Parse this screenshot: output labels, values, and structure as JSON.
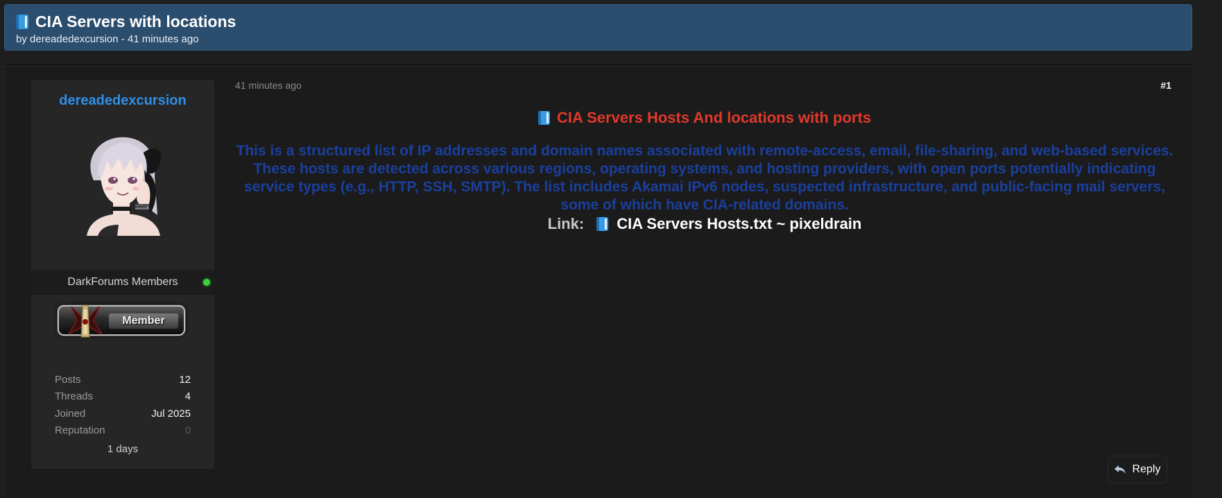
{
  "thread": {
    "title": "CIA Servers with locations",
    "by_prefix": "by",
    "author": "dereadedexcursion",
    "separator": "-",
    "time_ago": "41 minutes ago"
  },
  "post": {
    "date": "41 minutes ago",
    "number": "#1",
    "heading": "CIA Servers Hosts And locations with ports",
    "paragraph": "This is a structured list of IP addresses and domain names associated with remote-access, email, file-sharing, and web-based services. These hosts are detected across various regions, operating systems, and hosting providers, with open ports potentially indicating service types (e.g., HTTP, SSH, SMTP). The list includes Akamai IPv6 nodes, suspected infrastructure, and public-facing mail servers, some of which have CIA-related domains.",
    "link_label": "Link:",
    "link_text": "CIA Servers Hosts.txt ~ pixeldrain",
    "colors": {
      "heading": "#e0392b",
      "paragraph": "#1a3f9e"
    }
  },
  "author_card": {
    "username": "dereadedexcursion",
    "usergroup": "DarkForums Members",
    "online": true,
    "rank_badge": "Member",
    "stats": [
      {
        "label": "Posts",
        "value": "12"
      },
      {
        "label": "Threads",
        "value": "4"
      },
      {
        "label": "Joined",
        "value": "Jul 2025"
      },
      {
        "label": "Reputation",
        "value": "0"
      }
    ],
    "extra": "1 days"
  },
  "actions": {
    "reply_label": "Reply"
  },
  "icons": {
    "title": "book-icon",
    "reply": "reply-arrow-icon",
    "status": "online-status-icon"
  },
  "theme": {
    "header_bg": "#2b4d6e",
    "username_color": "#2f8fe8",
    "online_color": "#3ecf3e"
  }
}
